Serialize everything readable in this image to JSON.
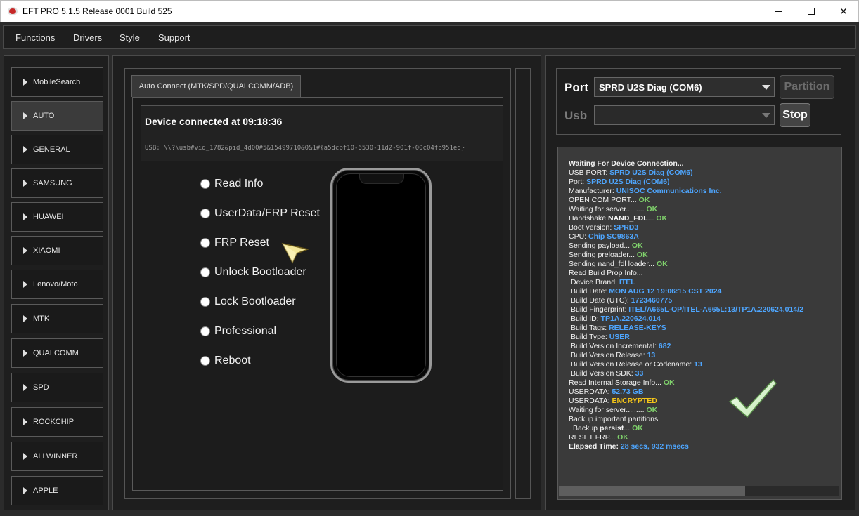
{
  "window": {
    "title": "EFT PRO 5.1.5 Release 0001 Build 525",
    "minimize_icon": "minimize-icon",
    "maximize_icon": "maximize-icon",
    "close_icon": "close-icon",
    "close_glyph": "✕"
  },
  "menu": [
    "Functions",
    "Drivers",
    "Style",
    "Support"
  ],
  "sidebar": {
    "items": [
      {
        "label": "MobileSearch",
        "active": false
      },
      {
        "label": "AUTO",
        "active": true
      },
      {
        "label": "GENERAL",
        "active": false
      },
      {
        "label": "SAMSUNG",
        "active": false
      },
      {
        "label": "HUAWEI",
        "active": false
      },
      {
        "label": "XIAOMI",
        "active": false
      },
      {
        "label": "Lenovo/Moto",
        "active": false
      },
      {
        "label": "MTK",
        "active": false
      },
      {
        "label": "QUALCOMM",
        "active": false
      },
      {
        "label": "SPD",
        "active": false
      },
      {
        "label": "ROCKCHIP",
        "active": false
      },
      {
        "label": "ALLWINNER",
        "active": false
      },
      {
        "label": "APPLE",
        "active": false
      }
    ]
  },
  "center": {
    "tab_label": "Auto Connect (MTK/SPD/QUALCOMM/ADB)",
    "device_status": "Device connected at 09:18:36",
    "usb_path": "USB: \\\\?\\usb#vid_1782&pid_4d00#5&15499710&0&1#{a5dcbf10-6530-11d2-901f-00c04fb951ed}",
    "options": [
      "Read Info",
      "UserData/FRP Reset",
      "FRP Reset",
      "Unlock Bootloader",
      "Lock Bootloader",
      "Professional",
      "Reboot"
    ]
  },
  "right": {
    "port_label": "Port",
    "port_value": "SPRD U2S Diag (COM6)",
    "usb_label": "Usb",
    "usb_value": "",
    "partition_button": "Partition",
    "stop_button": "Stop",
    "colors": {
      "value": "#4ea6ff",
      "ok": "#7fd16b",
      "warning": "#f5c518"
    },
    "log": [
      {
        "cls": "bold",
        "parts": [
          [
            "Waiting For Device Connection...",
            ""
          ]
        ]
      },
      {
        "cls": "",
        "parts": [
          [
            "USB PORT: ",
            ""
          ],
          [
            "SPRD U2S Diag (COM6)",
            "val"
          ]
        ]
      },
      {
        "cls": "",
        "parts": [
          [
            "Port: ",
            ""
          ],
          [
            "SPRD U2S Diag (COM6)",
            "val"
          ]
        ]
      },
      {
        "cls": "",
        "parts": [
          [
            "Manufacturer: ",
            ""
          ],
          [
            "UNISOC Communications Inc.",
            "val"
          ]
        ]
      },
      {
        "cls": "",
        "parts": [
          [
            "OPEN COM PORT... ",
            ""
          ],
          [
            "OK",
            "ok"
          ]
        ]
      },
      {
        "cls": "",
        "parts": [
          [
            "Waiting for server......... ",
            ""
          ],
          [
            "OK",
            "ok"
          ]
        ]
      },
      {
        "cls": "",
        "parts": [
          [
            "Handshake ",
            ""
          ],
          [
            "NAND_FDL",
            "b"
          ],
          [
            "... ",
            ""
          ],
          [
            "OK",
            "ok"
          ]
        ]
      },
      {
        "cls": "",
        "parts": [
          [
            "Boot version: ",
            ""
          ],
          [
            "SPRD3",
            "val"
          ]
        ]
      },
      {
        "cls": "",
        "parts": [
          [
            "CPU: ",
            ""
          ],
          [
            "Chip SC9863A",
            "val"
          ]
        ]
      },
      {
        "cls": "",
        "parts": [
          [
            "Sending payload... ",
            ""
          ],
          [
            "OK",
            "ok"
          ]
        ]
      },
      {
        "cls": "",
        "parts": [
          [
            "Sending preloader... ",
            ""
          ],
          [
            "OK",
            "ok"
          ]
        ]
      },
      {
        "cls": "",
        "parts": [
          [
            "Sending nand_fdl loader... ",
            ""
          ],
          [
            "OK",
            "ok"
          ]
        ]
      },
      {
        "cls": "",
        "parts": [
          [
            "Read Build Prop Info...",
            ""
          ]
        ]
      },
      {
        "cls": "indent",
        "parts": [
          [
            "Device Brand: ",
            ""
          ],
          [
            "ITEL",
            "val"
          ]
        ]
      },
      {
        "cls": "indent",
        "parts": [
          [
            "Build Date: ",
            ""
          ],
          [
            "MON AUG 12 19:06:15 CST 2024",
            "val"
          ]
        ]
      },
      {
        "cls": "indent",
        "parts": [
          [
            "Build Date (UTC): ",
            ""
          ],
          [
            "1723460775",
            "val"
          ]
        ]
      },
      {
        "cls": "indent",
        "parts": [
          [
            "Build Fingerprint: ",
            ""
          ],
          [
            "ITEL/A665L-OP/ITEL-A665L:13/TP1A.220624.014/2",
            "val"
          ]
        ]
      },
      {
        "cls": "indent",
        "parts": [
          [
            "Build ID: ",
            ""
          ],
          [
            "TP1A.220624.014",
            "val"
          ]
        ]
      },
      {
        "cls": "indent",
        "parts": [
          [
            "Build Tags: ",
            ""
          ],
          [
            "RELEASE-KEYS",
            "val"
          ]
        ]
      },
      {
        "cls": "indent",
        "parts": [
          [
            "Build Type: ",
            ""
          ],
          [
            "USER",
            "val"
          ]
        ]
      },
      {
        "cls": "indent",
        "parts": [
          [
            "Build Version Incremental: ",
            ""
          ],
          [
            "682",
            "val"
          ]
        ]
      },
      {
        "cls": "indent",
        "parts": [
          [
            "Build Version Release: ",
            ""
          ],
          [
            "13",
            "val"
          ]
        ]
      },
      {
        "cls": "indent",
        "parts": [
          [
            "Build Version Release or Codename: ",
            ""
          ],
          [
            "13",
            "val"
          ]
        ]
      },
      {
        "cls": "indent",
        "parts": [
          [
            "Build Version SDK: ",
            ""
          ],
          [
            "33",
            "val"
          ]
        ]
      },
      {
        "cls": "",
        "parts": [
          [
            "Read Internal Storage Info... ",
            ""
          ],
          [
            "OK",
            "ok"
          ]
        ]
      },
      {
        "cls": "",
        "parts": [
          [
            "USERDATA: ",
            ""
          ],
          [
            "52.73 GB",
            "val"
          ]
        ]
      },
      {
        "cls": "",
        "parts": [
          [
            "USERDATA: ",
            ""
          ],
          [
            "ENCRYPTED",
            "warn"
          ]
        ]
      },
      {
        "cls": "",
        "parts": [
          [
            "Waiting for server......... ",
            ""
          ],
          [
            "OK",
            "ok"
          ]
        ]
      },
      {
        "cls": "",
        "parts": [
          [
            "Backup important partitions",
            ""
          ]
        ]
      },
      {
        "cls": "sub",
        "parts": [
          [
            "Backup ",
            ""
          ],
          [
            "persist",
            "b"
          ],
          [
            "... ",
            ""
          ],
          [
            "OK",
            "ok"
          ]
        ]
      },
      {
        "cls": "",
        "parts": [
          [
            "RESET FRP... ",
            ""
          ],
          [
            "OK",
            "ok"
          ]
        ]
      },
      {
        "cls": "bold",
        "parts": [
          [
            "Elapsed Time: ",
            ""
          ],
          [
            "28 secs, 932 msecs",
            "val"
          ]
        ]
      }
    ],
    "success_icon": "checkmark-icon"
  }
}
